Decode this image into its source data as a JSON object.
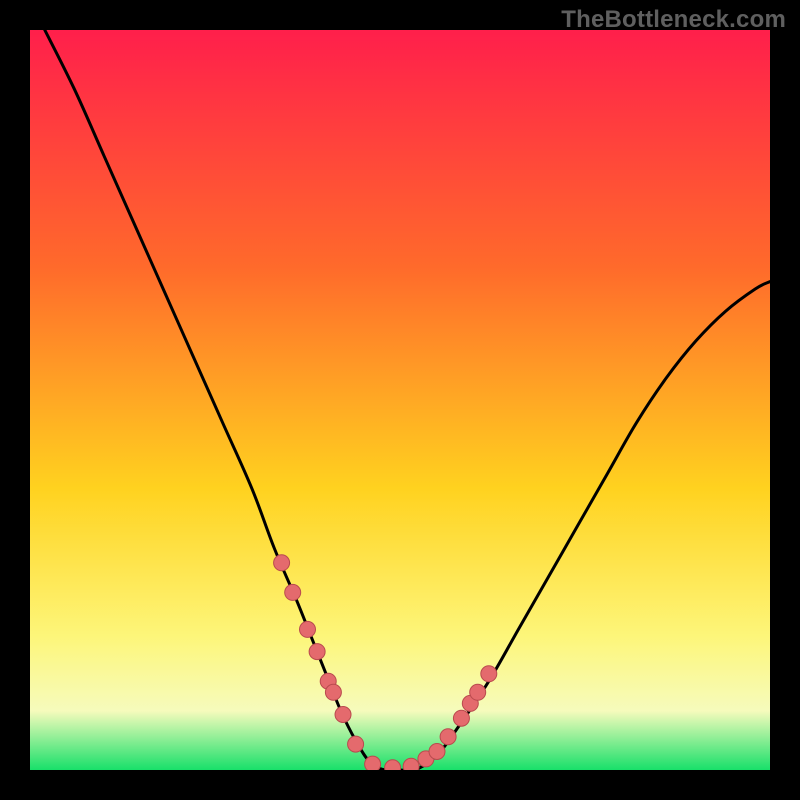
{
  "watermark": "TheBottleneck.com",
  "colors": {
    "page_bg": "#000000",
    "gradient_top": "#ff1f4b",
    "gradient_upper_mid": "#ff6a2b",
    "gradient_mid": "#ffd21f",
    "gradient_lower_mid": "#fdf67a",
    "gradient_band": "#f6fbbc",
    "gradient_bottom": "#18e06a",
    "curve": "#000000",
    "marker_fill": "#e46a6d",
    "marker_stroke": "#b94a4e"
  },
  "chart_data": {
    "type": "line",
    "title": "",
    "xlabel": "",
    "ylabel": "",
    "xlim": [
      0,
      100
    ],
    "ylim": [
      0,
      100
    ],
    "series": [
      {
        "name": "bottleneck-curve",
        "x": [
          2,
          6,
          10,
          14,
          18,
          22,
          26,
          30,
          33,
          36,
          38,
          40,
          42,
          44,
          46,
          48,
          50,
          52,
          55,
          58,
          62,
          66,
          70,
          74,
          78,
          82,
          86,
          90,
          94,
          98,
          100
        ],
        "y": [
          100,
          92,
          83,
          74,
          65,
          56,
          47,
          38,
          30,
          23,
          18,
          13,
          8,
          4,
          1,
          0,
          0,
          0,
          2,
          6,
          12,
          19,
          26,
          33,
          40,
          47,
          53,
          58,
          62,
          65,
          66
        ]
      }
    ],
    "markers": {
      "name": "highlight-points",
      "x": [
        34.0,
        35.5,
        37.5,
        38.8,
        40.3,
        41.0,
        42.3,
        44.0,
        46.3,
        49.0,
        51.5,
        53.5,
        55.0,
        56.5,
        58.3,
        59.5,
        60.5,
        62.0
      ],
      "y": [
        28.0,
        24.0,
        19.0,
        16.0,
        12.0,
        10.5,
        7.5,
        3.5,
        0.8,
        0.3,
        0.5,
        1.5,
        2.5,
        4.5,
        7.0,
        9.0,
        10.5,
        13.0
      ]
    },
    "annotations": []
  }
}
